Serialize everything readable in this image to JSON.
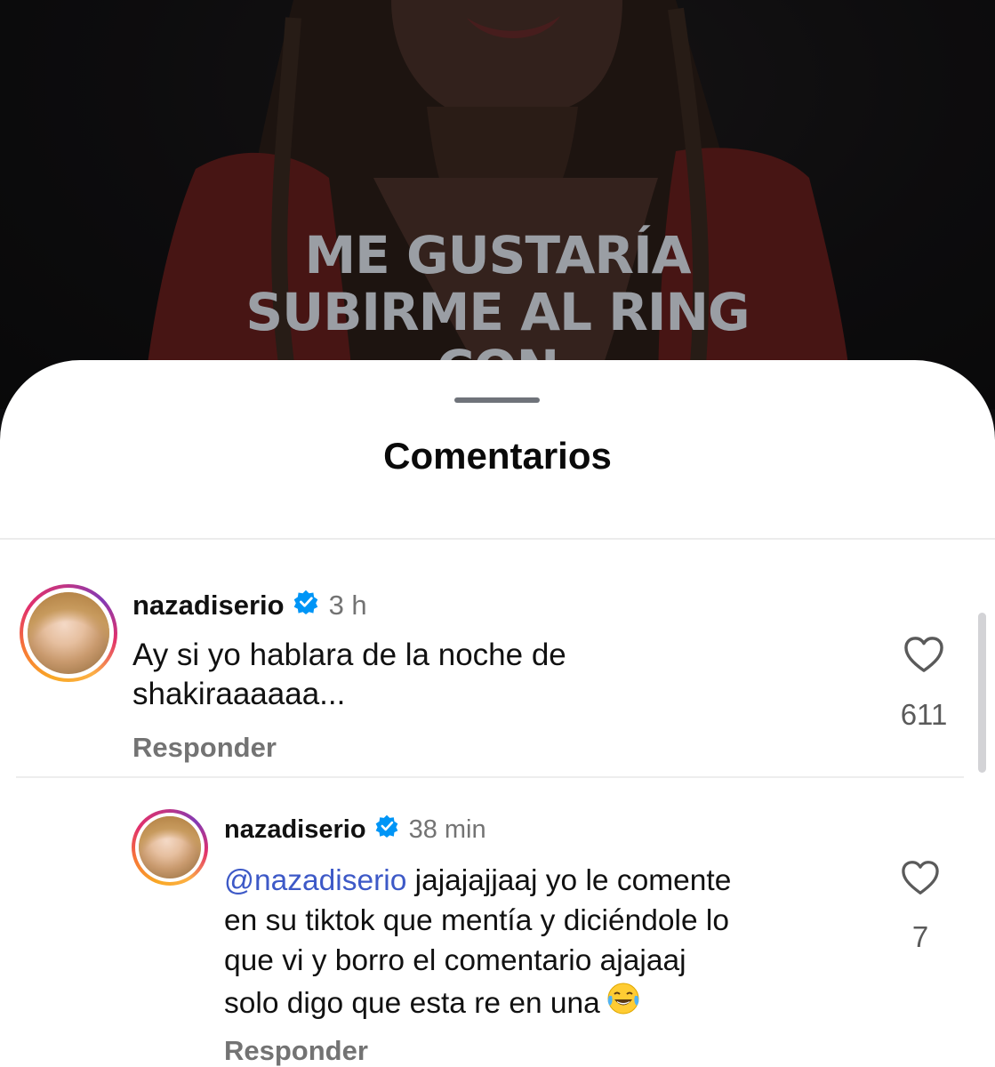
{
  "video": {
    "overlay_lines": [
      "ME GUSTARÍA",
      "SUBIRME AL RING",
      "CON"
    ]
  },
  "sheet": {
    "title": "Comentarios"
  },
  "comments": [
    {
      "username": "nazadiserio",
      "verified": true,
      "time": "3 h",
      "text_lines": [
        "Ay si yo hablara de la noche de",
        "shakiraaaaaa..."
      ],
      "reply_label": "Responder",
      "likes": "611"
    },
    {
      "username": "nazadiserio",
      "verified": true,
      "time": "38 min",
      "mention": "@nazadiserio",
      "text_lines": [
        " jajajajjaaj yo le comente",
        "en su tiktok que mentía y diciéndole lo",
        "que vi y borro el comentario ajajaaj",
        "solo digo que esta re en una"
      ],
      "emoji": "😂",
      "reply_label": "Responder",
      "likes": "7"
    }
  ],
  "colors": {
    "verified_badge": "#0095f6",
    "mention": "#3d59c7",
    "secondary_text": "#737373"
  },
  "icons": [
    "verified-badge-icon",
    "heart-icon",
    "tears-of-joy-emoji"
  ]
}
